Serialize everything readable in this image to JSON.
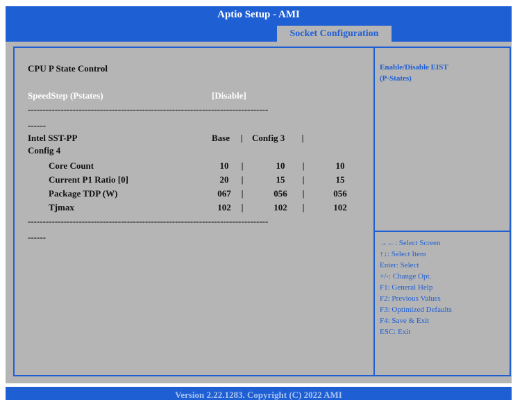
{
  "app": {
    "title": "Aptio Setup  - AMI",
    "active_tab": "Socket Configuration"
  },
  "main": {
    "section_title": "CPU P State Control",
    "speedstep": {
      "label": "SpeedStep (Pstates)",
      "value": "[Disable]"
    },
    "separator": "--------------------------------------------------------------------------------",
    "separator_tail": "------",
    "sst": {
      "label": "Intel SST-PP",
      "header_base": "Base",
      "header_config3": "Config 3",
      "label_line2": "Config 4",
      "pipe": "|",
      "rows": [
        {
          "label": "Core Count",
          "base": "10",
          "config3": "10",
          "config4": "10"
        },
        {
          "label": "Current P1 Ratio [0]",
          "base": "20",
          "config3": "15",
          "config4": "15"
        },
        {
          "label": "Package TDP (W)",
          "base": "067",
          "config3": "056",
          "config4": "056"
        },
        {
          "label": "Tjmax",
          "base": "102",
          "config3": "102",
          "config4": "102"
        }
      ]
    }
  },
  "help": {
    "description_line1": "Enable/Disable EIST",
    "description_line2": "(P-States)",
    "keys": [
      "→←: Select Screen",
      "↑↓: Select Item",
      "Enter: Select",
      "+/-: Change Opt.",
      "F1: General Help",
      "F2: Previous Values",
      "F3: Optimized Defaults",
      "F4: Save & Exit",
      "ESC: Exit"
    ]
  },
  "footer": {
    "version": "Version 2.22.1283. Copyright (C) 2022 AMI"
  }
}
